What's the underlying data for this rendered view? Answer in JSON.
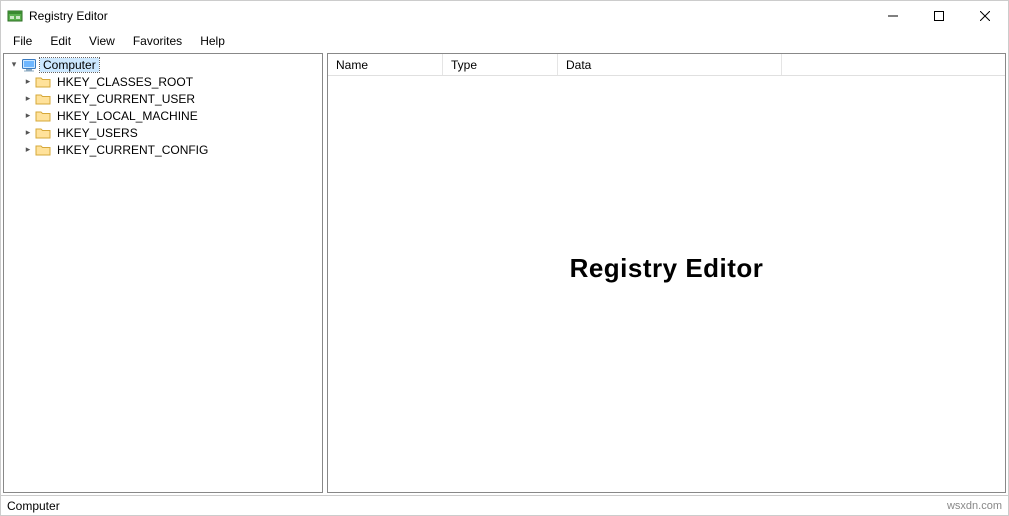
{
  "window": {
    "title": "Registry Editor"
  },
  "menu": {
    "file": "File",
    "edit": "Edit",
    "view": "View",
    "favorites": "Favorites",
    "help": "Help"
  },
  "tree": {
    "root": "Computer",
    "children": [
      "HKEY_CLASSES_ROOT",
      "HKEY_CURRENT_USER",
      "HKEY_LOCAL_MACHINE",
      "HKEY_USERS",
      "HKEY_CURRENT_CONFIG"
    ]
  },
  "columns": {
    "name": "Name",
    "type": "Type",
    "data": "Data"
  },
  "overlay": "Registry Editor",
  "status": {
    "path": "Computer"
  },
  "watermark": "wsxdn.com"
}
